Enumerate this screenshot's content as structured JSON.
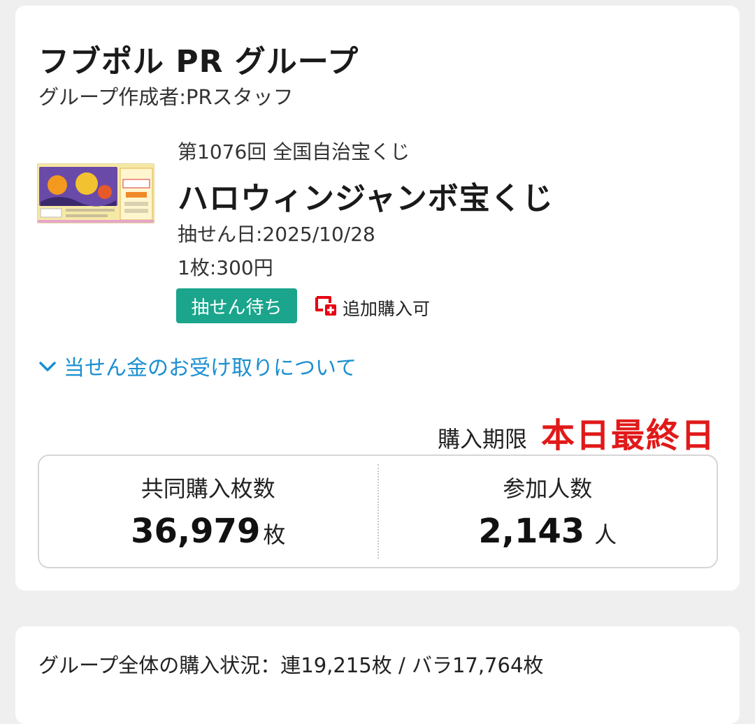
{
  "group": {
    "title": "フブポル PR グループ",
    "creator": "グループ作成者:PRスタッフ"
  },
  "lottery": {
    "round": "第1076回 全国自治宝くじ",
    "name": "ハロウィンジャンボ宝くじ",
    "draw_date": "抽せん日:2025/10/28",
    "price": "1枚:300円",
    "status": "抽せん待ち",
    "additional_purchase": "追加購入可",
    "additional_icon": "cart-plus-icon"
  },
  "prize_link": {
    "label": "当せん金のお受け取りについて",
    "icon": "chevron-down-icon"
  },
  "deadline": {
    "label": "購入期限",
    "value": "本日最終日"
  },
  "stats": {
    "tickets_label": "共同購入枚数",
    "tickets_value": "36,979",
    "tickets_unit": "枚",
    "members_label": "参加人数",
    "members_value": "2,143",
    "members_unit": "人"
  },
  "purchase_status": "グループ全体の購入状況：連19,215枚 / バラ17,764枚",
  "colors": {
    "accent_blue": "#1a8fd0",
    "badge_green": "#1aa58c",
    "deadline_red": "#e11919",
    "icon_red": "#e60012"
  }
}
